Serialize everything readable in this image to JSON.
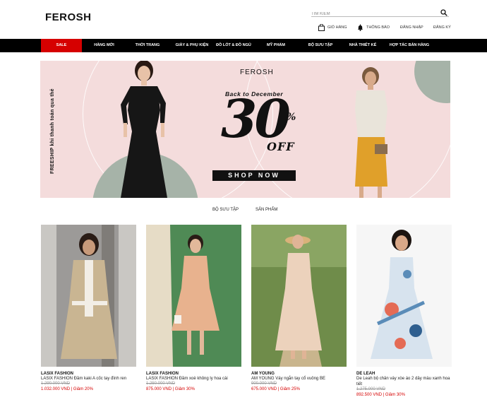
{
  "header": {
    "logo": "FEROSH",
    "search_placeholder": "TÌM KIẾM"
  },
  "utility": {
    "cart": "GIỎ HÀNG",
    "notifications": "THÔNG BÁO",
    "login": "ĐĂNG NHẬP",
    "register": "ĐĂNG KÝ"
  },
  "nav": {
    "items": [
      {
        "label": "SALE"
      },
      {
        "label": "HÀNG MỚI"
      },
      {
        "label": "THỜI TRANG"
      },
      {
        "label": "GIÀY & PHỤ KIỆN"
      },
      {
        "label": "ĐỒ LÓT & ĐỒ NGỦ"
      },
      {
        "label": "MỸ PHẨM"
      },
      {
        "label": "BỘ SƯU TẬP"
      },
      {
        "label": "NHÀ THIẾT KẾ"
      },
      {
        "label": "HỢP TÁC BÁN HÀNG"
      }
    ]
  },
  "banner": {
    "brand": "FEROSH",
    "subtitle": "Back to December",
    "discount_number": "30",
    "discount_percent": "%",
    "discount_off": "OFF",
    "cta": "SHOP NOW",
    "freeship": "FREESHIP khi thanh toán qua thẻ"
  },
  "tabs": [
    {
      "label": "BỘ SƯU TẬP"
    },
    {
      "label": "SẢN PHẨM"
    }
  ],
  "products": [
    {
      "brand": "LASIX FASHION",
      "name": "LASIX FASHION Đầm kaki A cốc tay đính ren",
      "old_price": "1.290.000 VND",
      "price": "1.032.000 VND | Giảm 20%"
    },
    {
      "brand": "LASIX FASHION",
      "name": "LASIX FASHION Đầm xoè không ly hoa cài",
      "old_price": "1.250.000 VND",
      "price": "875.000 VND | Giảm 30%"
    },
    {
      "brand": "AM YOUNG",
      "name": "AM YOUNG Váy ngắn tay cổ vuông BE",
      "old_price": "900.000 VND",
      "price": "675.000 VND | Giảm 25%"
    },
    {
      "brand": "DE LEAH",
      "name": "De Leah bộ chân váy xòe áo 2 dây màu xanh hoa tiết",
      "old_price": "1.275.000 VND",
      "price": "892.500 VND | Giảm 30%"
    }
  ],
  "colors": {
    "sale": "#d60000",
    "nav_bg": "#000000",
    "banner_bg": "#f4dcdc",
    "price": "#d60000"
  }
}
